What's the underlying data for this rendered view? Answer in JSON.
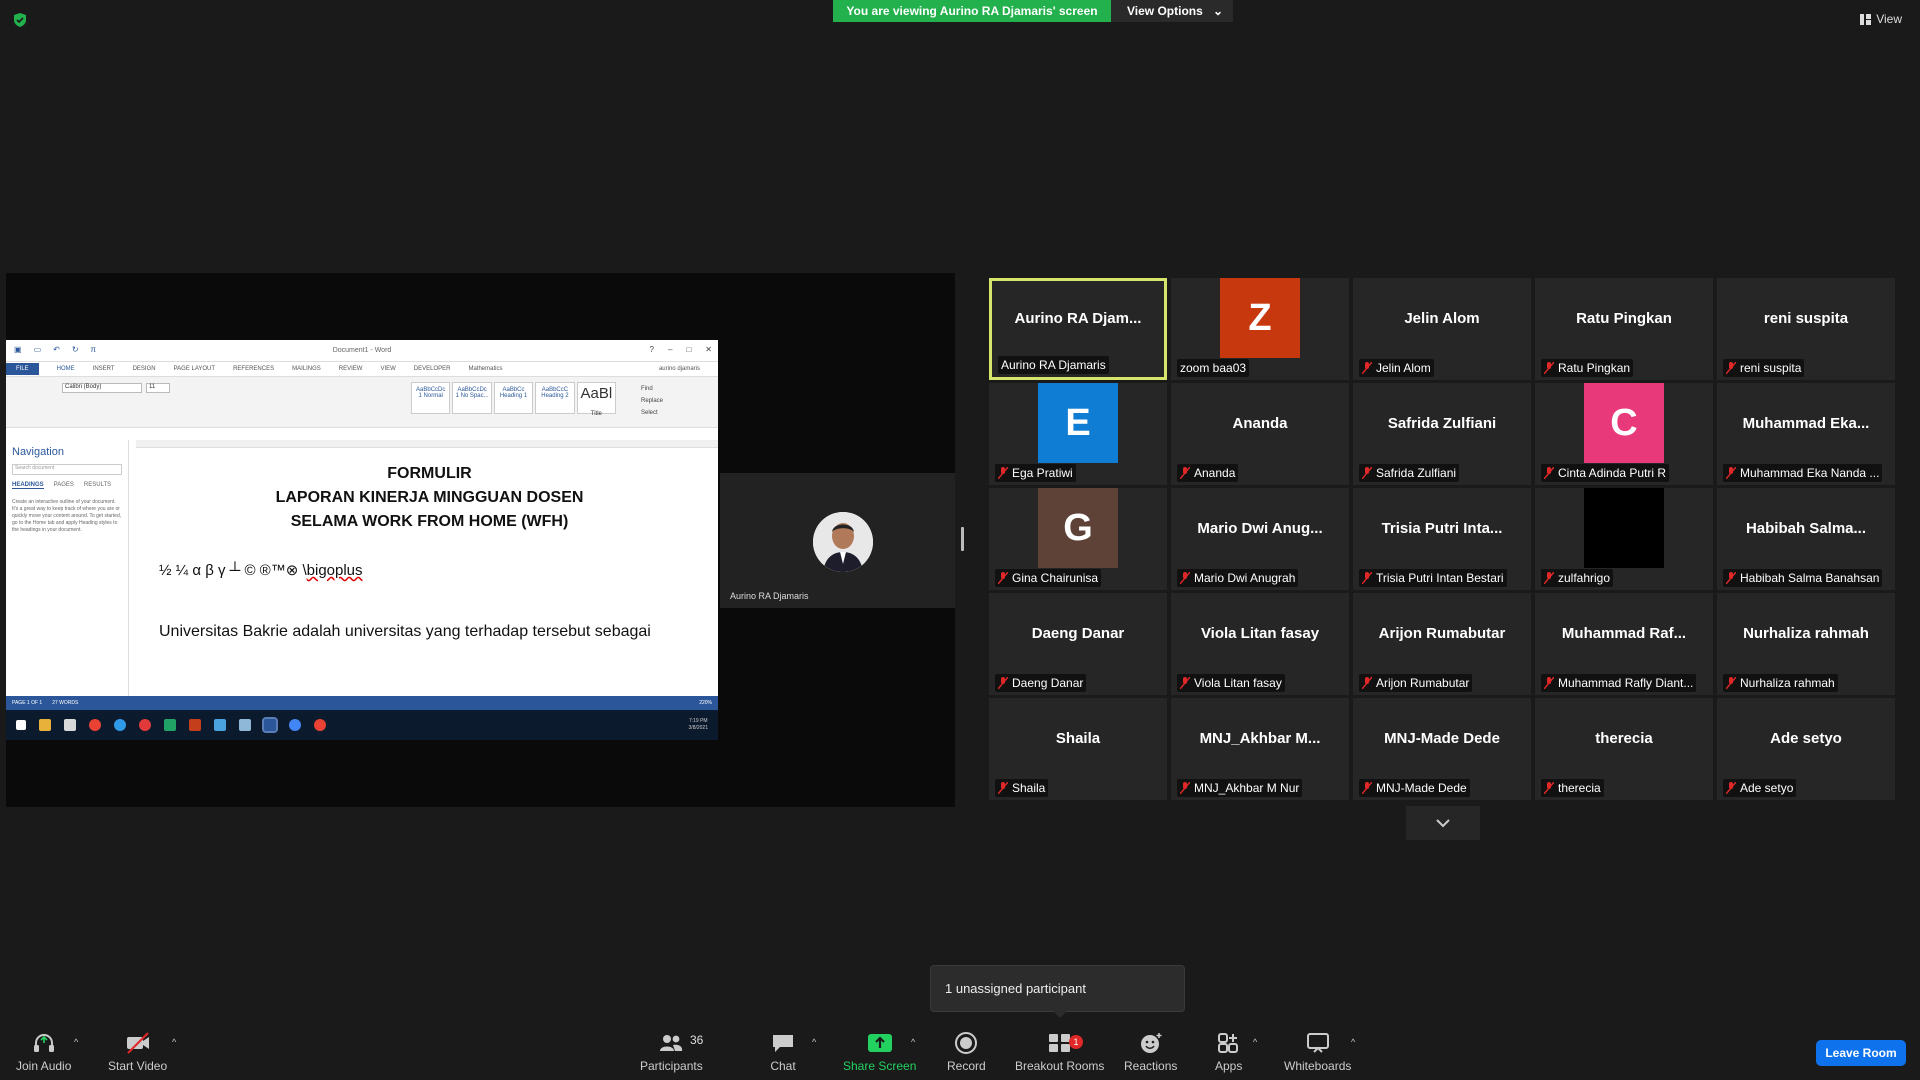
{
  "top": {
    "banner_text": "You are viewing Aurino RA Djamaris' screen",
    "view_options_label": "View Options",
    "view_label": "View"
  },
  "shared_screen": {
    "word": {
      "window_title": "Document1 - Word",
      "tabs": [
        "FILE",
        "HOME",
        "INSERT",
        "DESIGN",
        "PAGE LAYOUT",
        "REFERENCES",
        "MAILINGS",
        "REVIEW",
        "VIEW",
        "DEVELOPER",
        "Mathematics"
      ],
      "user": "aurino djamaris",
      "font_name": "Calibri (Body)",
      "font_size": "11",
      "styles": [
        "AaBbCcDc",
        "AaBbCcDc",
        "AaBbCc",
        "AaBbCcC",
        "AaBl"
      ],
      "style_names": [
        "1 Normal",
        "1 No Spac...",
        "Heading 1",
        "Heading 2",
        "Title"
      ],
      "edit_items": [
        "Find",
        "Replace",
        "Select"
      ],
      "nav_title": "Navigation",
      "nav_search": "Search document",
      "nav_tabs": [
        "HEADINGS",
        "PAGES",
        "RESULTS"
      ],
      "nav_text": "Create an interactive outline of your document. It's a great way to keep track of where you are or quickly move your content around. To get started, go to the Home tab and apply Heading styles to the headings in your document.",
      "doc_title_1": "FORMULIR",
      "doc_title_2": "LAPORAN KINERJA MINGGUAN DOSEN",
      "doc_title_3": "SELAMA WORK FROM HOME (WFH)",
      "doc_symbols": "½ ¼ α β γ ┴ © ®™⊗ \\",
      "doc_symbols_tail": "bigoplus",
      "doc_line": "Universitas Bakrie adalah universitas yang terhadap tersebut sebagai",
      "status_page": "PAGE 1 OF 1",
      "status_words": "27 WORDS",
      "zoom": "220%",
      "clock_time": "7:19 PM",
      "clock_date": "3/8/2021"
    },
    "presenter_name": "Aurino RA Djamaris"
  },
  "gallery": [
    {
      "center": "Aurino RA Djam...",
      "label": "Aurino RA Djamaris",
      "muted": false,
      "active": true
    },
    {
      "avatar": "Z",
      "avatar_color": "#c8380e",
      "label": "zoom baa03",
      "muted": false
    },
    {
      "center": "Jelin Alom",
      "label": "Jelin Alom",
      "muted": true
    },
    {
      "center": "Ratu Pingkan",
      "label": "Ratu Pingkan",
      "muted": true
    },
    {
      "center": "reni suspita",
      "label": "reni suspita",
      "muted": true
    },
    {
      "avatar": "E",
      "avatar_color": "#0f7dd4",
      "label": "Ega Pratiwi",
      "muted": true
    },
    {
      "center": "Ananda",
      "label": "Ananda",
      "muted": true
    },
    {
      "center": "Safrida Zulfiani",
      "label": "Safrida Zulfiani",
      "muted": true
    },
    {
      "avatar": "C",
      "avatar_color": "#e8397a",
      "label": "Cinta Adinda Putri R",
      "muted": true
    },
    {
      "center": "Muhammad Eka...",
      "label": "Muhammad Eka Nanda ...",
      "muted": true
    },
    {
      "avatar": "G",
      "avatar_color": "#5e4238",
      "label": "Gina Chairunisa",
      "muted": true
    },
    {
      "center": "Mario Dwi Anug...",
      "label": "Mario Dwi Anugrah",
      "muted": true
    },
    {
      "center": "Trisia Putri Inta...",
      "label": "Trisia Putri Intan Bestari",
      "muted": true
    },
    {
      "avatar": "",
      "avatar_color": "#000000",
      "label": "zulfahrigo",
      "muted": true
    },
    {
      "center": "Habibah Salma...",
      "label": "Habibah Salma Banahsan",
      "muted": true
    },
    {
      "center": "Daeng Danar",
      "label": "Daeng Danar",
      "muted": true
    },
    {
      "center": "Viola Litan fasay",
      "label": "Viola Litan fasay",
      "muted": true
    },
    {
      "center": "Arijon Rumabutar",
      "label": "Arijon Rumabutar",
      "muted": true
    },
    {
      "center": "Muhammad Raf...",
      "label": "Muhammad Rafly Diant...",
      "muted": true
    },
    {
      "center": "Nurhaliza rahmah",
      "label": "Nurhaliza rahmah",
      "muted": true
    },
    {
      "center": "Shaila",
      "label": "Shaila",
      "muted": true
    },
    {
      "center": "MNJ_Akhbar M...",
      "label": "MNJ_Akhbar M Nur",
      "muted": true
    },
    {
      "center": "MNJ-Made Dede",
      "label": "MNJ-Made Dede",
      "muted": true
    },
    {
      "center": "therecia",
      "label": "therecia",
      "muted": true
    },
    {
      "center": "Ade setyo",
      "label": "Ade setyo",
      "muted": true
    }
  ],
  "toast": {
    "text": "1 unassigned participant"
  },
  "toolbar": {
    "join_audio": "Join Audio",
    "start_video": "Start Video",
    "participants": "Participants",
    "participants_count": "36",
    "chat": "Chat",
    "share_screen": "Share Screen",
    "record": "Record",
    "breakout_rooms": "Breakout Rooms",
    "breakout_badge": "1",
    "reactions": "Reactions",
    "apps": "Apps",
    "whiteboards": "Whiteboards",
    "leave_room": "Leave Room"
  },
  "colors": {
    "banner": "#23b14d",
    "active_border": "#d6e56b",
    "leave": "#0e72ed",
    "share_green": "#23d160"
  }
}
